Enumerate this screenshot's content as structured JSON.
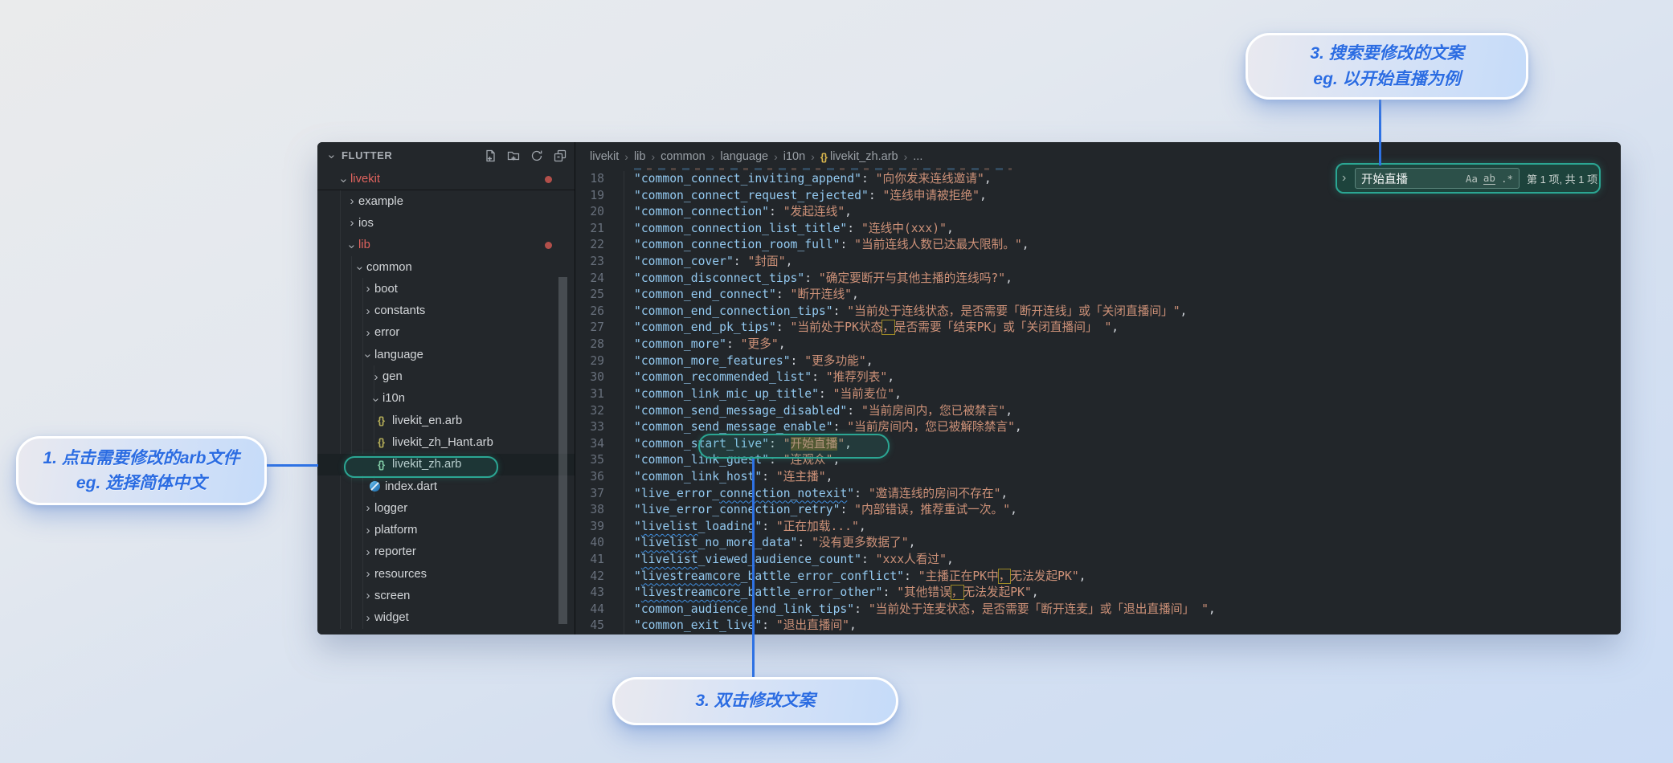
{
  "colors": {
    "accent_teal": "#2ba693",
    "callout_blue": "#2b6ce2",
    "modified_red": "#e0635e"
  },
  "sidebar": {
    "header_title": "FLUTTER",
    "action_icons": [
      "new-file-icon",
      "new-folder-icon",
      "refresh-icon",
      "collapse-folders-icon"
    ],
    "root": {
      "label": "livekit",
      "modified": true
    },
    "tree": [
      {
        "label": "example",
        "level": 1,
        "kind": "folder",
        "state": "collapsed"
      },
      {
        "label": "ios",
        "level": 1,
        "kind": "folder",
        "state": "collapsed"
      },
      {
        "label": "lib",
        "level": 1,
        "kind": "folder",
        "state": "expanded",
        "modified": true,
        "dot": true
      },
      {
        "label": "common",
        "level": 2,
        "kind": "folder",
        "state": "expanded"
      },
      {
        "label": "boot",
        "level": 3,
        "kind": "folder",
        "state": "collapsed"
      },
      {
        "label": "constants",
        "level": 3,
        "kind": "folder",
        "state": "collapsed"
      },
      {
        "label": "error",
        "level": 3,
        "kind": "folder",
        "state": "collapsed"
      },
      {
        "label": "language",
        "level": 3,
        "kind": "folder",
        "state": "expanded"
      },
      {
        "label": "gen",
        "level": 4,
        "kind": "folder",
        "state": "collapsed"
      },
      {
        "label": "i10n",
        "level": 4,
        "kind": "folder",
        "state": "expanded"
      },
      {
        "label": "livekit_en.arb",
        "level": 5,
        "kind": "file",
        "icon": "braces-icon"
      },
      {
        "label": "livekit_zh_Hant.arb",
        "level": 5,
        "kind": "file",
        "icon": "braces-icon"
      },
      {
        "label": "livekit_zh.arb",
        "level": 5,
        "kind": "file",
        "icon": "braces-icon",
        "selected": true
      },
      {
        "label": "index.dart",
        "level": 4,
        "kind": "file",
        "icon": "dart-icon"
      },
      {
        "label": "logger",
        "level": 3,
        "kind": "folder",
        "state": "collapsed"
      },
      {
        "label": "platform",
        "level": 3,
        "kind": "folder",
        "state": "collapsed"
      },
      {
        "label": "reporter",
        "level": 3,
        "kind": "folder",
        "state": "collapsed"
      },
      {
        "label": "resources",
        "level": 3,
        "kind": "folder",
        "state": "collapsed"
      },
      {
        "label": "screen",
        "level": 3,
        "kind": "folder",
        "state": "collapsed"
      },
      {
        "label": "widget",
        "level": 3,
        "kind": "folder",
        "state": "collapsed"
      }
    ]
  },
  "breadcrumb": {
    "segments": [
      {
        "label": "livekit"
      },
      {
        "label": "lib"
      },
      {
        "label": "common"
      },
      {
        "label": "language"
      },
      {
        "label": "i10n"
      },
      {
        "label": "livekit_zh.arb",
        "icon": "braces-icon"
      },
      {
        "label": "..."
      }
    ]
  },
  "find": {
    "toggle": "›",
    "query": "开始直播",
    "match_case_icon": "Aa",
    "whole_word_icon": "ab",
    "regex_icon": ".*",
    "results": "第 1 项, 共 1 项"
  },
  "editor": {
    "lines": [
      {
        "n": 18,
        "key": "common_connect_inviting_append",
        "value": "向你发来连线邀请"
      },
      {
        "n": 19,
        "key": "common_connect_request_rejected",
        "value": "连线申请被拒绝"
      },
      {
        "n": 20,
        "key": "common_connection",
        "value": "发起连线"
      },
      {
        "n": 21,
        "key": "common_connection_list_title",
        "value": "连线中(xxx)"
      },
      {
        "n": 22,
        "key": "common_connection_room_full",
        "value": "当前连线人数已达最大限制。"
      },
      {
        "n": 23,
        "key": "common_cover",
        "value": "封面"
      },
      {
        "n": 24,
        "key": "common_disconnect_tips",
        "value": "确定要断开与其他主播的连线吗?"
      },
      {
        "n": 25,
        "key": "common_end_connect",
        "value": "断开连线"
      },
      {
        "n": 26,
        "key": "common_end_connection_tips",
        "value": "当前处于连线状态，是否需要「断开连线」或「关闭直播间」"
      },
      {
        "n": 27,
        "key": "common_end_pk_tips",
        "value": "当前处于PK状态，是否需要「结束PK」或「关闭直播间」 ",
        "ubox": true
      },
      {
        "n": 28,
        "key": "common_more",
        "value": "更多"
      },
      {
        "n": 29,
        "key": "common_more_features",
        "value": "更多功能"
      },
      {
        "n": 30,
        "key": "common_recommended_list",
        "value": "推荐列表"
      },
      {
        "n": 31,
        "key": "common_link_mic_up_title",
        "value": "当前麦位"
      },
      {
        "n": 32,
        "key": "common_send_message_disabled",
        "value": "当前房间内，您已被禁言"
      },
      {
        "n": 33,
        "key": "common_send_message_enable",
        "value": "当前房间内，您已被解除禁言"
      },
      {
        "n": 34,
        "key": "common_start_live",
        "value": "开始直播",
        "highlight": true
      },
      {
        "n": 35,
        "key": "common_link_guest",
        "value": "连观众"
      },
      {
        "n": 36,
        "key": "common_link_host",
        "value": "连主播"
      },
      {
        "n": 37,
        "key": "live_error_connection_notexit",
        "value": "邀请连线的房间不存在",
        "squiggle": "connection_notexit"
      },
      {
        "n": 38,
        "key": "live_error_connection_retry",
        "value": "内部错误，推荐重试一次。"
      },
      {
        "n": 39,
        "key": "livelist_loading",
        "value": "正在加载...",
        "squiggle": "livelist"
      },
      {
        "n": 40,
        "key": "livelist_no_more_data",
        "value": "没有更多数据了",
        "squiggle": "livelist"
      },
      {
        "n": 41,
        "key": "livelist_viewed_audience_count",
        "value": "xxx人看过",
        "squiggle": "livelist"
      },
      {
        "n": 42,
        "key": "livestreamcore_battle_error_conflict",
        "value": "主播正在PK中，无法发起PK",
        "squiggle": "livestreamcore",
        "ubox": true
      },
      {
        "n": 43,
        "key": "livestreamcore_battle_error_other",
        "value": "其他错误，无法发起PK",
        "squiggle": "livestreamcore",
        "ubox": true
      },
      {
        "n": 44,
        "key": "common_audience_end_link_tips",
        "value": "当前处于连麦状态，是否需要「断开连麦」或「退出直播间」 "
      },
      {
        "n": 45,
        "key": "common_exit_live",
        "value": "退出直播间"
      }
    ]
  },
  "annotations": {
    "callout_file": {
      "line1": "1. 点击需要修改的arb文件",
      "line2": "eg. 选择简体中文"
    },
    "callout_search": {
      "line1": "3. 搜索要修改的文案",
      "line2": "eg. 以开始直播为例"
    },
    "callout_edit": {
      "line1": "3. 双击修改文案"
    }
  }
}
